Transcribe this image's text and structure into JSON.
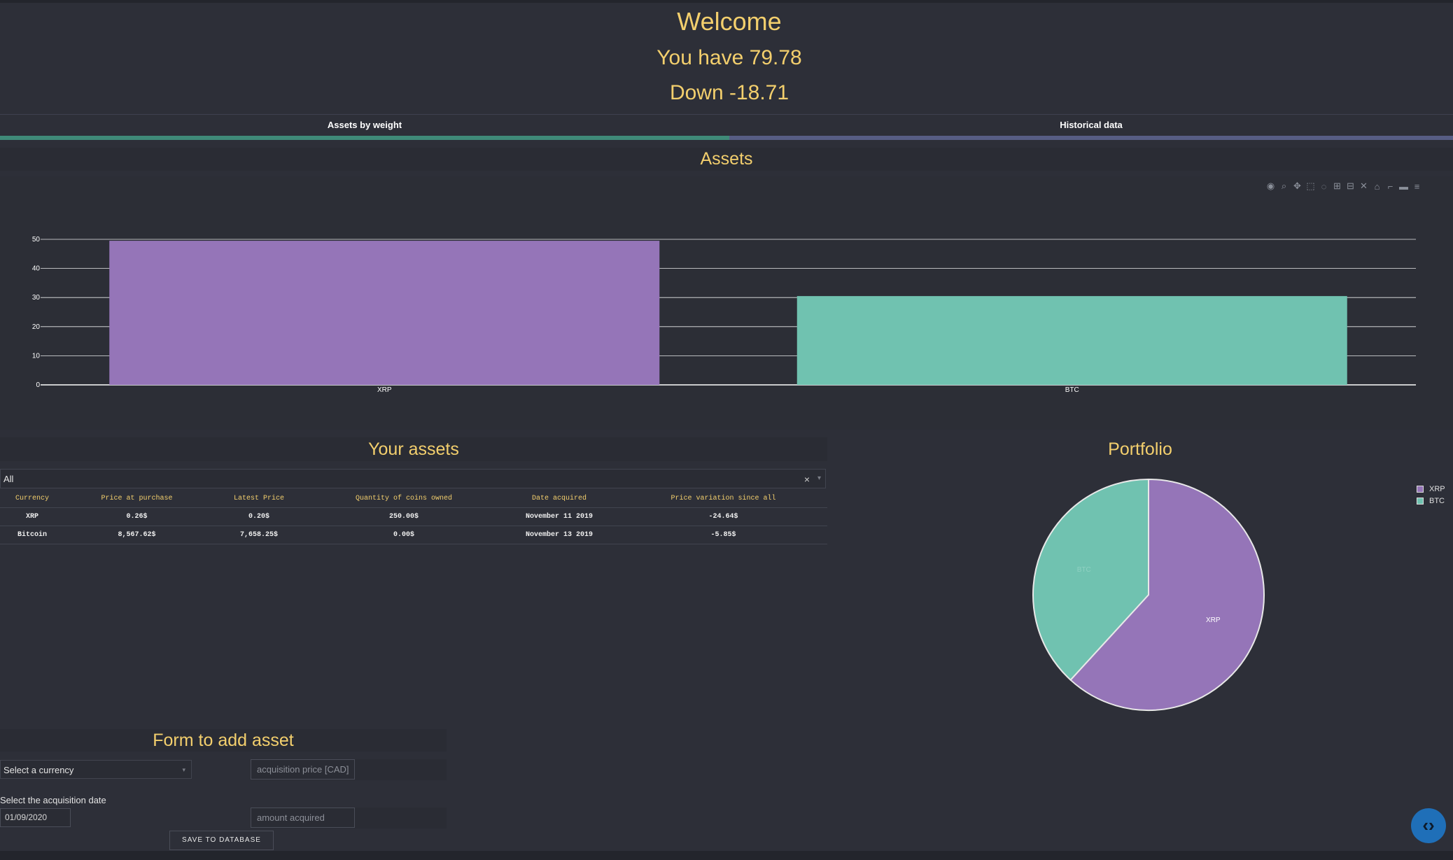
{
  "header": {
    "welcome": "Welcome",
    "balance": "You have 79.78",
    "change": "Down -18.71"
  },
  "tabs": [
    {
      "label": "Assets by weight"
    },
    {
      "label": "Historical data"
    }
  ],
  "assets_section": {
    "title": "Assets"
  },
  "modebar": {
    "icons": [
      "camera-icon",
      "zoom-icon",
      "pan-icon",
      "box-select-icon",
      "lasso-icon",
      "zoom-in-icon",
      "zoom-out-icon",
      "autoscale-icon",
      "home-icon",
      "spike-icon",
      "hover-closest-icon",
      "hover-compare-icon"
    ]
  },
  "table_section": {
    "title": "Your assets",
    "filter": {
      "value": "All",
      "clear": "×",
      "arrow": "▾"
    },
    "columns": [
      "Currency",
      "Price at purchase",
      "Latest Price",
      "Quantity of coins owned",
      "Date acquired",
      "Price variation since all"
    ],
    "rows": [
      [
        "XRP",
        "0.26$",
        "0.20$",
        "250.00$",
        "November 11 2019",
        "-24.64$"
      ],
      [
        "Bitcoin",
        "8,567.62$",
        "7,658.25$",
        "0.00$",
        "November 13 2019",
        "-5.85$"
      ]
    ]
  },
  "portfolio": {
    "title": "Portfolio"
  },
  "form": {
    "title": "Form to add asset",
    "currency_placeholder": "Select a currency",
    "price_placeholder": "acquisition price [CAD]",
    "date_label": "Select the acquisition date",
    "date_value": "01/09/2020",
    "amount_placeholder": "amount acquired",
    "save_label": "SAVE TO DATABASE"
  },
  "colors": {
    "accent": "#f3cf6d",
    "xrp": "#9575b8",
    "btc": "#70c2b0",
    "tab1": "#3f8a78",
    "tab2": "#575d84"
  },
  "chart_data": [
    {
      "type": "bar",
      "categories": [
        "XRP",
        "BTC"
      ],
      "values": [
        49.5,
        30.5
      ],
      "ylim": [
        0,
        50
      ],
      "yticks": [
        0,
        10,
        20,
        30,
        40,
        50
      ],
      "grid": true
    },
    {
      "type": "pie",
      "labels": [
        "XRP",
        "BTC"
      ],
      "values": [
        61.8,
        38.2
      ],
      "legend": "top-right"
    }
  ]
}
